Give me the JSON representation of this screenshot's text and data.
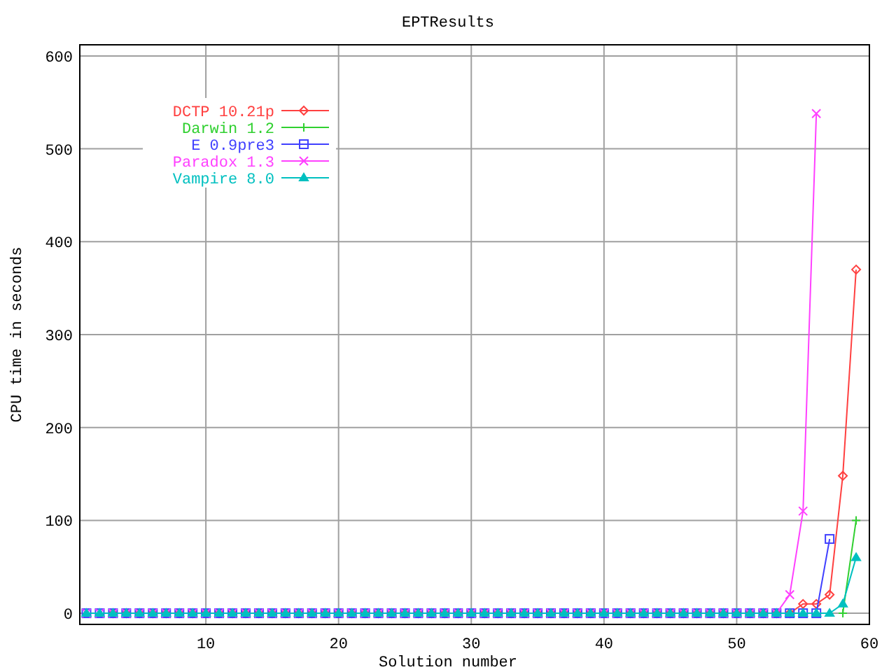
{
  "chart": {
    "chart_data": {
      "type": "line",
      "title": "EPTResults",
      "xlabel": "Solution number",
      "ylabel": "CPU time in seconds",
      "x": [
        1,
        2,
        3,
        4,
        5,
        6,
        7,
        8,
        9,
        10,
        11,
        12,
        13,
        14,
        15,
        16,
        17,
        18,
        19,
        20,
        21,
        22,
        23,
        24,
        25,
        26,
        27,
        28,
        29,
        30,
        31,
        32,
        33,
        34,
        35,
        36,
        37,
        38,
        39,
        40,
        41,
        42,
        43,
        44,
        45,
        46,
        47,
        48,
        49,
        50,
        51,
        52,
        53,
        54,
        55,
        56,
        57,
        58,
        59
      ],
      "series": [
        {
          "name": "DCTP 10.21p",
          "color": "#ff4040",
          "marker": "diamond",
          "values": [
            null,
            null,
            0,
            0,
            0,
            0,
            0,
            0,
            0,
            0,
            0,
            0,
            0,
            0,
            0,
            0,
            0,
            0,
            0,
            0,
            0,
            0,
            0,
            0,
            0,
            0,
            0,
            0,
            0,
            0,
            0,
            0,
            0,
            0,
            0,
            0,
            0,
            0,
            0,
            0,
            0,
            0,
            0,
            0,
            0,
            0,
            0,
            0,
            0,
            0,
            0,
            0,
            0,
            0,
            10,
            10,
            20,
            148,
            370
          ]
        },
        {
          "name": "Darwin 1.2",
          "color": "#30d030",
          "marker": "plus",
          "values": [
            null,
            null,
            null,
            null,
            null,
            null,
            null,
            null,
            null,
            null,
            null,
            null,
            null,
            null,
            null,
            null,
            null,
            null,
            null,
            null,
            null,
            null,
            null,
            null,
            null,
            null,
            null,
            null,
            null,
            null,
            null,
            null,
            null,
            null,
            null,
            null,
            null,
            null,
            null,
            null,
            null,
            null,
            null,
            null,
            null,
            null,
            null,
            null,
            null,
            null,
            null,
            null,
            null,
            null,
            null,
            null,
            null,
            0,
            100
          ]
        },
        {
          "name": "E 0.9pre3",
          "color": "#4040ff",
          "marker": "square",
          "values": [
            0,
            0,
            0,
            0,
            0,
            0,
            0,
            0,
            0,
            0,
            0,
            0,
            0,
            0,
            0,
            0,
            0,
            0,
            0,
            0,
            0,
            0,
            0,
            0,
            0,
            0,
            0,
            0,
            0,
            0,
            0,
            0,
            0,
            0,
            0,
            0,
            0,
            0,
            0,
            0,
            0,
            0,
            0,
            0,
            0,
            0,
            0,
            0,
            0,
            0,
            0,
            0,
            0,
            0,
            0,
            0,
            80,
            null,
            null
          ]
        },
        {
          "name": "Paradox 1.3",
          "color": "#ff40ff",
          "marker": "x",
          "values": [
            0,
            0,
            0,
            0,
            0,
            0,
            0,
            0,
            0,
            0,
            0,
            0,
            0,
            0,
            0,
            0,
            0,
            0,
            0,
            0,
            0,
            0,
            0,
            0,
            0,
            0,
            0,
            0,
            0,
            0,
            0,
            0,
            0,
            0,
            0,
            0,
            0,
            0,
            0,
            0,
            0,
            0,
            0,
            0,
            0,
            0,
            0,
            0,
            0,
            0,
            0,
            0,
            0,
            20,
            110,
            538,
            null,
            null,
            null
          ]
        },
        {
          "name": "Vampire 8.0",
          "color": "#00c0c0",
          "marker": "triangle",
          "values": [
            0,
            0,
            0,
            0,
            0,
            0,
            0,
            0,
            0,
            0,
            0,
            0,
            0,
            0,
            0,
            0,
            0,
            0,
            0,
            0,
            0,
            0,
            0,
            0,
            0,
            0,
            0,
            0,
            0,
            0,
            0,
            0,
            0,
            0,
            0,
            0,
            0,
            0,
            0,
            0,
            0,
            0,
            0,
            0,
            0,
            0,
            0,
            0,
            0,
            0,
            0,
            0,
            0,
            0,
            0,
            0,
            0,
            10,
            60
          ]
        }
      ],
      "xlim": [
        0.5,
        60
      ],
      "ylim": [
        -12,
        612
      ],
      "xticks": [
        10,
        20,
        30,
        40,
        50,
        60
      ],
      "yticks": [
        0,
        100,
        200,
        300,
        400,
        500,
        600
      ],
      "grid": true,
      "legend": true
    }
  }
}
